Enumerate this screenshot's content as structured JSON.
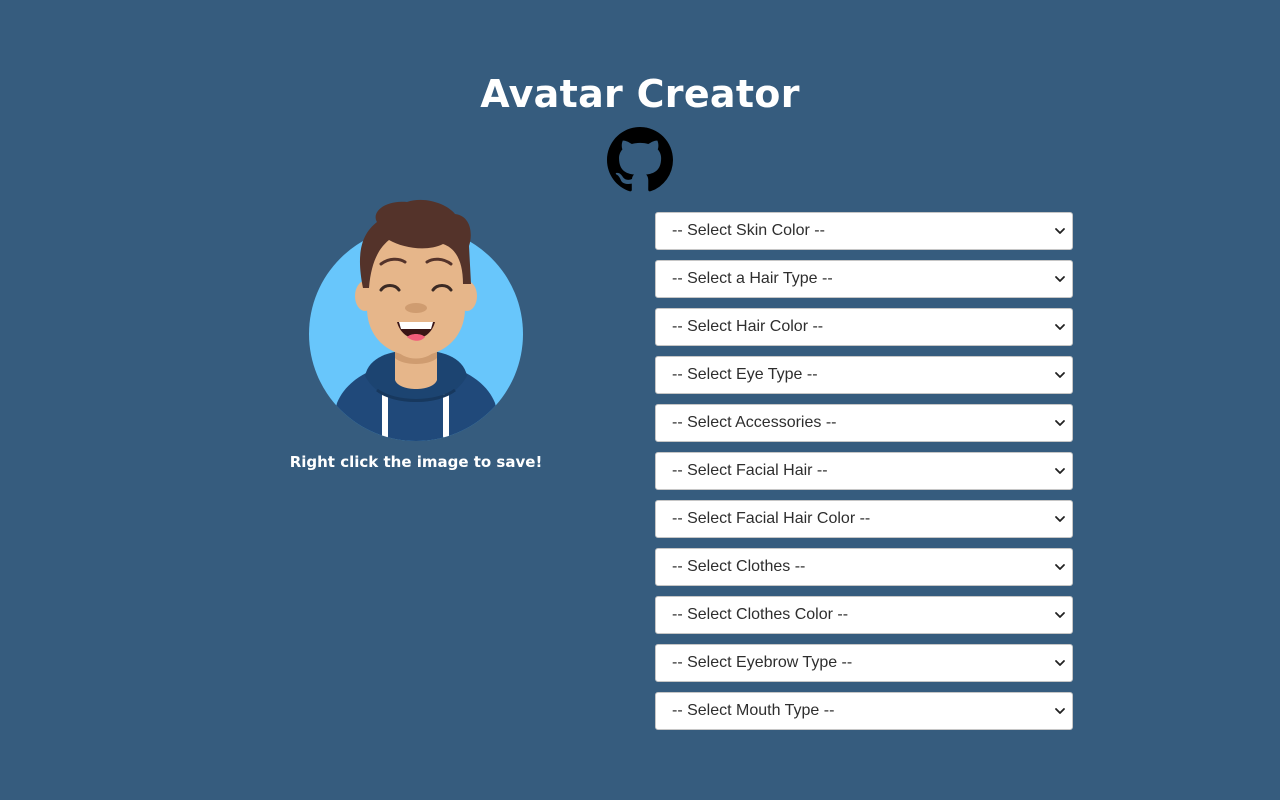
{
  "header": {
    "title": "Avatar Creator",
    "github_icon": "github-icon"
  },
  "avatar": {
    "hint": "Right click the image to save!",
    "colors": {
      "background": "#68c6fb",
      "skin": "#e6b68a",
      "hair": "#54332a",
      "hoodie": "#20497a"
    }
  },
  "selects": [
    {
      "name": "skin-color-select",
      "label": "-- Select Skin Color --"
    },
    {
      "name": "hair-type-select",
      "label": "-- Select a Hair Type --"
    },
    {
      "name": "hair-color-select",
      "label": "-- Select Hair Color --"
    },
    {
      "name": "eye-type-select",
      "label": "-- Select Eye Type --"
    },
    {
      "name": "accessories-select",
      "label": "-- Select Accessories --"
    },
    {
      "name": "facial-hair-select",
      "label": "-- Select Facial Hair --"
    },
    {
      "name": "facial-hair-color-select",
      "label": "-- Select Facial Hair Color --"
    },
    {
      "name": "clothes-select",
      "label": "-- Select Clothes --"
    },
    {
      "name": "clothes-color-select",
      "label": "-- Select Clothes Color --"
    },
    {
      "name": "eyebrow-type-select",
      "label": "-- Select Eyebrow Type --"
    },
    {
      "name": "mouth-type-select",
      "label": "-- Select Mouth Type --"
    }
  ],
  "theme": {
    "page_background": "#365c7e",
    "text_color": "#ffffff"
  }
}
